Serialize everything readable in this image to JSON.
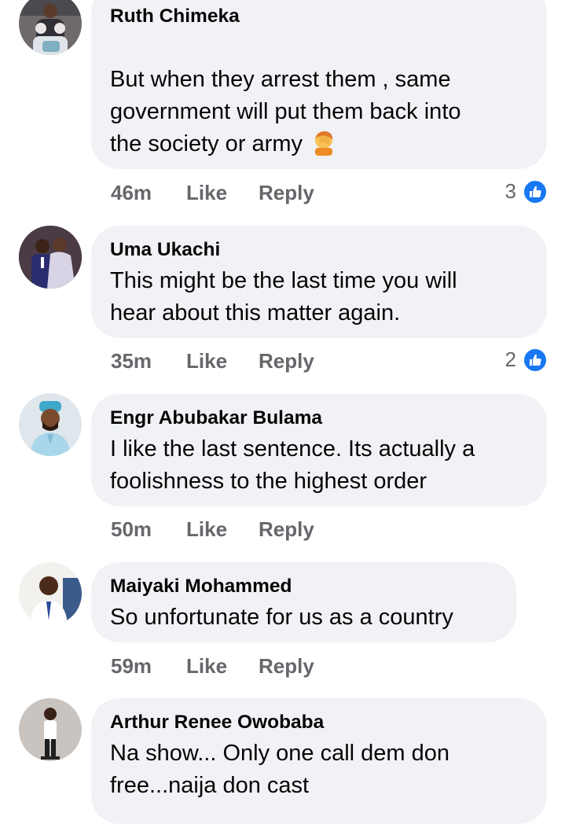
{
  "comments": [
    {
      "author": "Ruth Chimeka",
      "text": "But when they arrest them , same\ngovernment will put them back into\nthe society or army",
      "emoji": "facepalm-emoji",
      "time": "46m",
      "like_label": "Like",
      "reply_label": "Reply",
      "reaction_count": "3"
    },
    {
      "author": "Uma Ukachi",
      "text": "This might be the last time you will\nhear about this matter again.",
      "time": "35m",
      "like_label": "Like",
      "reply_label": "Reply",
      "reaction_count": "2"
    },
    {
      "author": "Engr Abubakar Bulama",
      "text": "I like the last sentence. Its actually a\nfoolishness to the highest order",
      "time": "50m",
      "like_label": "Like",
      "reply_label": "Reply"
    },
    {
      "author": "Maiyaki Mohammed",
      "text": "So unfortunate for us as a country",
      "time": "59m",
      "like_label": "Like",
      "reply_label": "Reply"
    },
    {
      "author": "Arthur Renee Owobaba",
      "text": "Na show... Only one call dem don\nfree...naija don cast"
    }
  ],
  "colors": {
    "bubble": "#f0f2f5",
    "meta_text": "#65676b",
    "like_badge": "#1877f2"
  },
  "icons": {
    "reaction": "like-thumb-icon"
  }
}
